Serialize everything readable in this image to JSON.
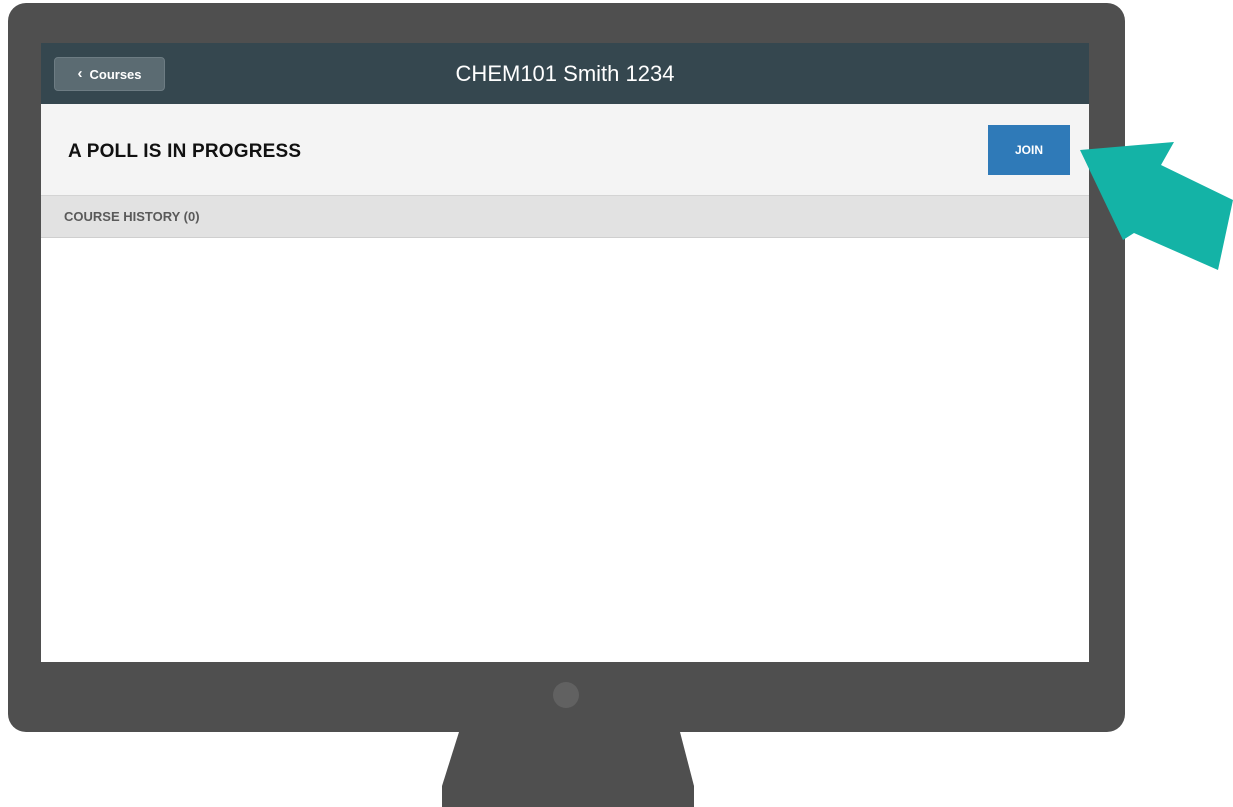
{
  "navbar": {
    "back_label": "Courses",
    "title": "CHEM101 Smith 1234"
  },
  "poll": {
    "status_text": "A POLL IS IN PROGRESS",
    "join_label": "JOIN"
  },
  "history": {
    "label": "COURSE HISTORY (0)"
  },
  "colors": {
    "navbar": "#35474f",
    "join_button": "#2f7ab8",
    "monitor": "#4f4f4f",
    "arrow": "#14b3a6"
  },
  "icons": {
    "back": "chevron-left-icon",
    "pointer": "arrow-pointer-icon",
    "camera": "camera-dot-icon"
  }
}
